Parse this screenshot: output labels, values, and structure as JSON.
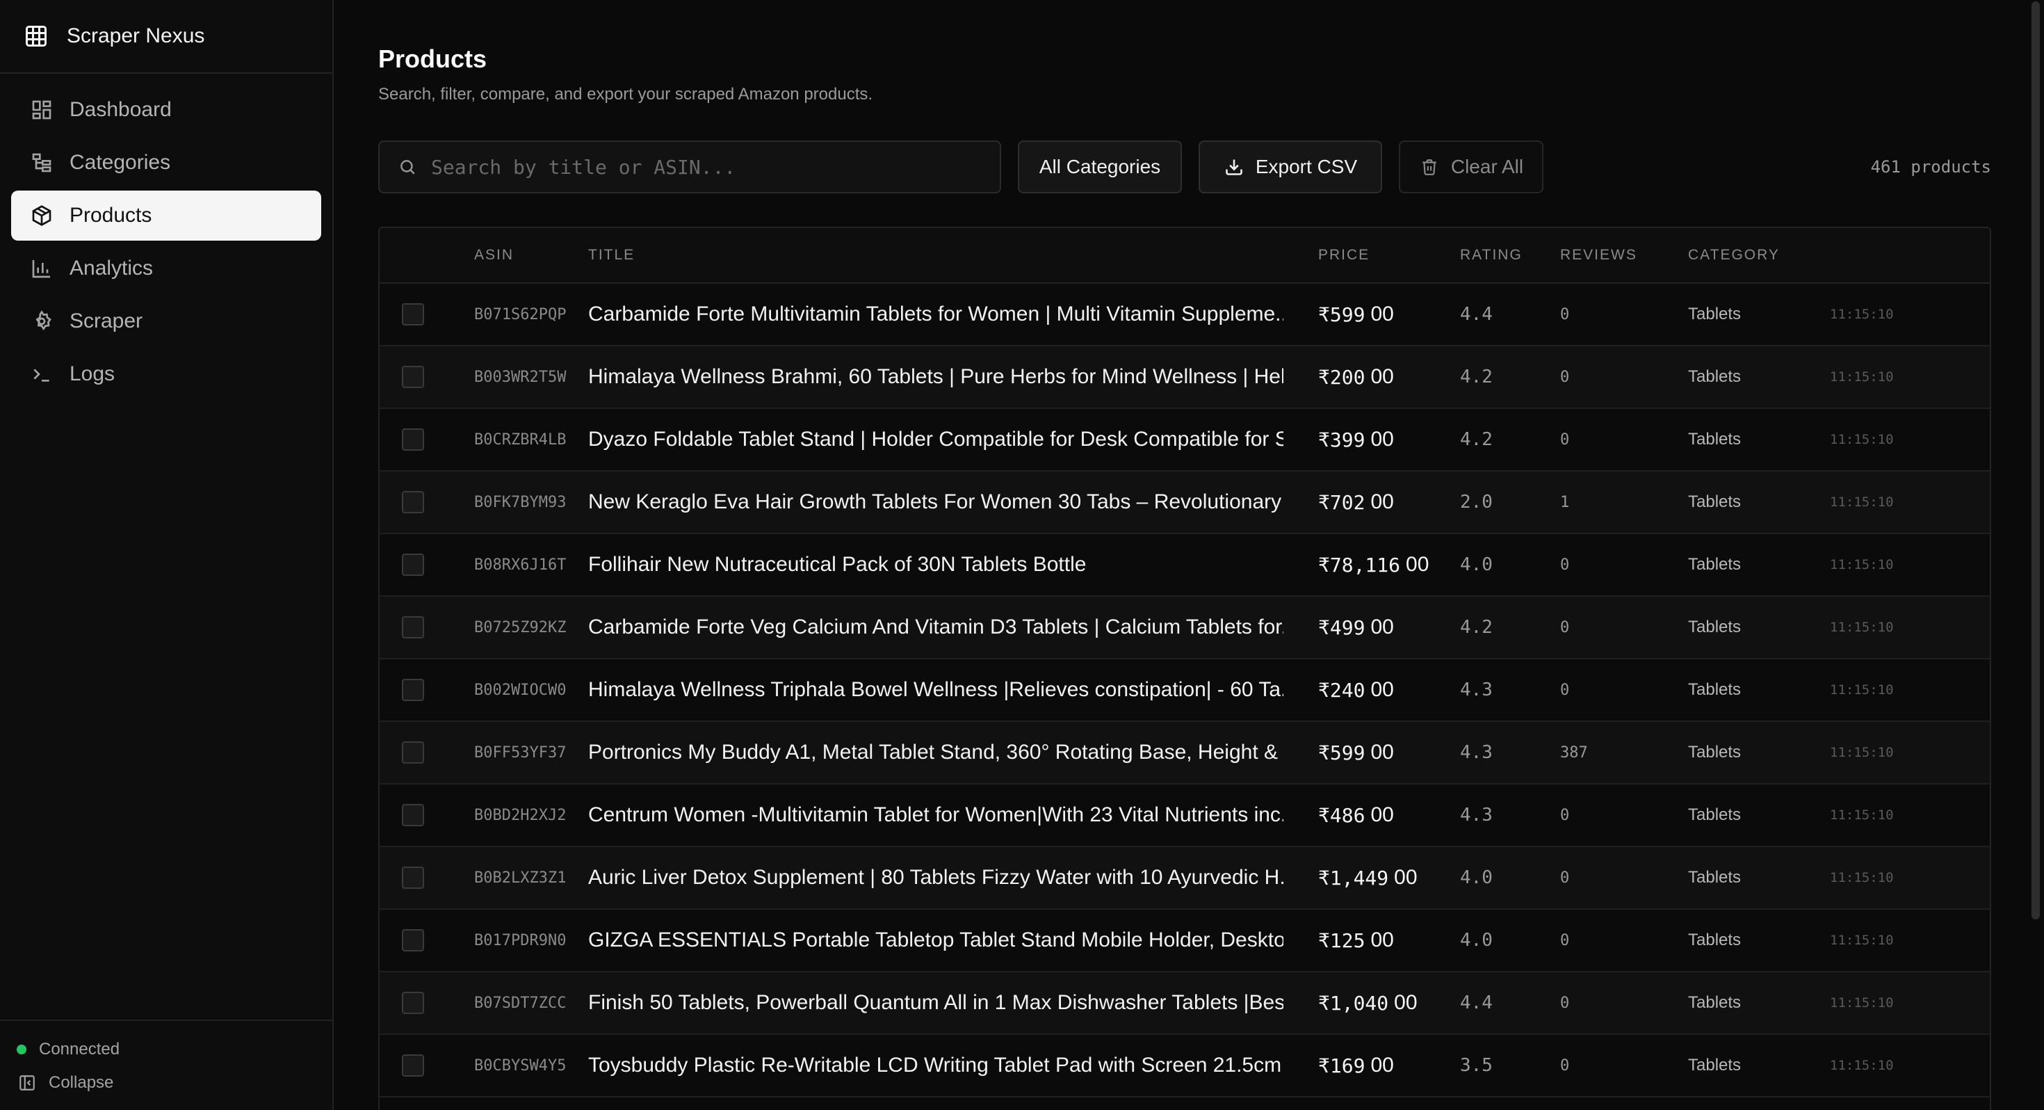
{
  "app": {
    "name": "Scraper Nexus"
  },
  "sidebar": {
    "items": [
      {
        "label": "Dashboard",
        "icon": "dashboard-icon"
      },
      {
        "label": "Categories",
        "icon": "tree-icon"
      },
      {
        "label": "Products",
        "icon": "box-icon",
        "active": true
      },
      {
        "label": "Analytics",
        "icon": "bar-chart-icon"
      },
      {
        "label": "Scraper",
        "icon": "gear-icon"
      },
      {
        "label": "Logs",
        "icon": "terminal-icon"
      }
    ],
    "status": "Connected",
    "collapse_label": "Collapse"
  },
  "page": {
    "title": "Products",
    "subtitle": "Search, filter, compare, and export your scraped Amazon products."
  },
  "toolbar": {
    "search_placeholder": "Search by title or ASIN...",
    "category_label": "All Categories",
    "export_label": "Export CSV",
    "clear_label": "Clear All",
    "count_text": "461 products"
  },
  "table": {
    "headers": {
      "asin": "ASIN",
      "title": "TITLE",
      "price": "PRICE",
      "rating": "RATING",
      "reviews": "REVIEWS",
      "category": "CATEGORY"
    },
    "rows": [
      {
        "asin": "B071S62PQP",
        "title": "Carbamide Forte Multivitamin Tablets for Women | Multi Vitamin Suppleme...",
        "price": "₹599",
        "dec": "00",
        "rating": "4.4",
        "reviews": "0",
        "category": "Tablets",
        "time": "11:15:10"
      },
      {
        "asin": "B003WR2T5W",
        "title": "Himalaya Wellness Brahmi, 60 Tablets | Pure Herbs for Mind Wellness | Hel...",
        "price": "₹200",
        "dec": "00",
        "rating": "4.2",
        "reviews": "0",
        "category": "Tablets",
        "time": "11:15:10"
      },
      {
        "asin": "B0CRZBR4LB",
        "title": "Dyazo Foldable Tablet Stand | Holder Compatible for Desk Compatible for S...",
        "price": "₹399",
        "dec": "00",
        "rating": "4.2",
        "reviews": "0",
        "category": "Tablets",
        "time": "11:15:10"
      },
      {
        "asin": "B0FK7BYM93",
        "title": "New Keraglo Eva Hair Growth Tablets For Women 30 Tabs – Revolutionary ...",
        "price": "₹702",
        "dec": "00",
        "rating": "2.0",
        "reviews": "1",
        "category": "Tablets",
        "time": "11:15:10"
      },
      {
        "asin": "B08RX6J16T",
        "title": "Follihair New Nutraceutical Pack of 30N Tablets Bottle",
        "price": "₹78,116",
        "dec": "00",
        "rating": "4.0",
        "reviews": "0",
        "category": "Tablets",
        "time": "11:15:10"
      },
      {
        "asin": "B0725Z92KZ",
        "title": "Carbamide Forte Veg Calcium And Vitamin D3 Tablets | Calcium Tablets for...",
        "price": "₹499",
        "dec": "00",
        "rating": "4.2",
        "reviews": "0",
        "category": "Tablets",
        "time": "11:15:10"
      },
      {
        "asin": "B002WIOCW0",
        "title": "Himalaya Wellness Triphala Bowel Wellness |Relieves constipation| - 60 Ta...",
        "price": "₹240",
        "dec": "00",
        "rating": "4.3",
        "reviews": "0",
        "category": "Tablets",
        "time": "11:15:10"
      },
      {
        "asin": "B0FF53YF37",
        "title": "Portronics My Buddy A1, Metal Tablet Stand, 360° Rotating Base, Height & ...",
        "price": "₹599",
        "dec": "00",
        "rating": "4.3",
        "reviews": "387",
        "category": "Tablets",
        "time": "11:15:10"
      },
      {
        "asin": "B0BD2H2XJ2",
        "title": "Centrum Women -Multivitamin Tablet for Women|With 23 Vital Nutrients inc...",
        "price": "₹486",
        "dec": "00",
        "rating": "4.3",
        "reviews": "0",
        "category": "Tablets",
        "time": "11:15:10"
      },
      {
        "asin": "B0B2LXZ3Z1",
        "title": "Auric Liver Detox Supplement | 80 Tablets Fizzy Water with 10 Ayurvedic H...",
        "price": "₹1,449",
        "dec": "00",
        "rating": "4.0",
        "reviews": "0",
        "category": "Tablets",
        "time": "11:15:10"
      },
      {
        "asin": "B017PDR9N0",
        "title": "GIZGA ESSENTIALS Portable Tabletop Tablet Stand Mobile Holder, Desktop...",
        "price": "₹125",
        "dec": "00",
        "rating": "4.0",
        "reviews": "0",
        "category": "Tablets",
        "time": "11:15:10"
      },
      {
        "asin": "B07SDT7ZCC",
        "title": "Finish 50 Tablets, Powerball Quantum All in 1 Max Dishwasher Tablets |Best...",
        "price": "₹1,040",
        "dec": "00",
        "rating": "4.4",
        "reviews": "0",
        "category": "Tablets",
        "time": "11:15:10"
      },
      {
        "asin": "B0CBYSW4Y5",
        "title": "Toysbuddy Plastic Re-Writable LCD Writing Tablet Pad with Screen 21.5cm ...",
        "price": "₹169",
        "dec": "00",
        "rating": "3.5",
        "reviews": "0",
        "category": "Tablets",
        "time": "11:15:10"
      }
    ]
  }
}
